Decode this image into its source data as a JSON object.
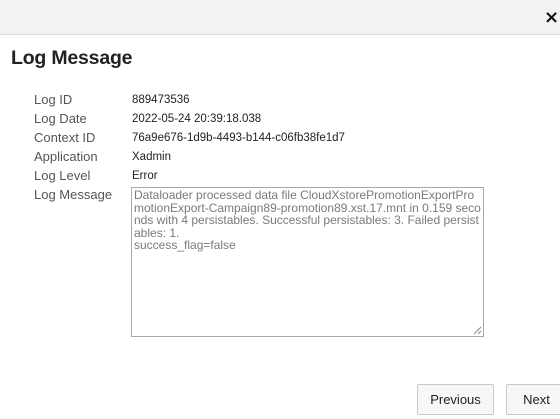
{
  "dialog": {
    "close_glyph": "×",
    "title": "Log Message"
  },
  "fields": [
    {
      "label": "Log ID",
      "value": "889473536"
    },
    {
      "label": "Log Date",
      "value": "2022-05-24 20:39:18.038"
    },
    {
      "label": "Context ID",
      "value": "76a9e676-1d9b-4493-b144-c06fb38fe1d7"
    },
    {
      "label": "Application",
      "value": "Xadmin"
    },
    {
      "label": "Log Level",
      "value": "Error"
    }
  ],
  "message": {
    "label": "Log Message",
    "text": "Dataloader processed data file CloudXstorePromotionExportPromotionExport-Campaign89-promotion89.xst.17.mnt in 0.159 seconds with 4 persistables. Successful persistables: 3. Failed persistables: 1.\nsuccess_flag=false"
  },
  "buttons": {
    "previous": "Previous",
    "next": "Next"
  }
}
